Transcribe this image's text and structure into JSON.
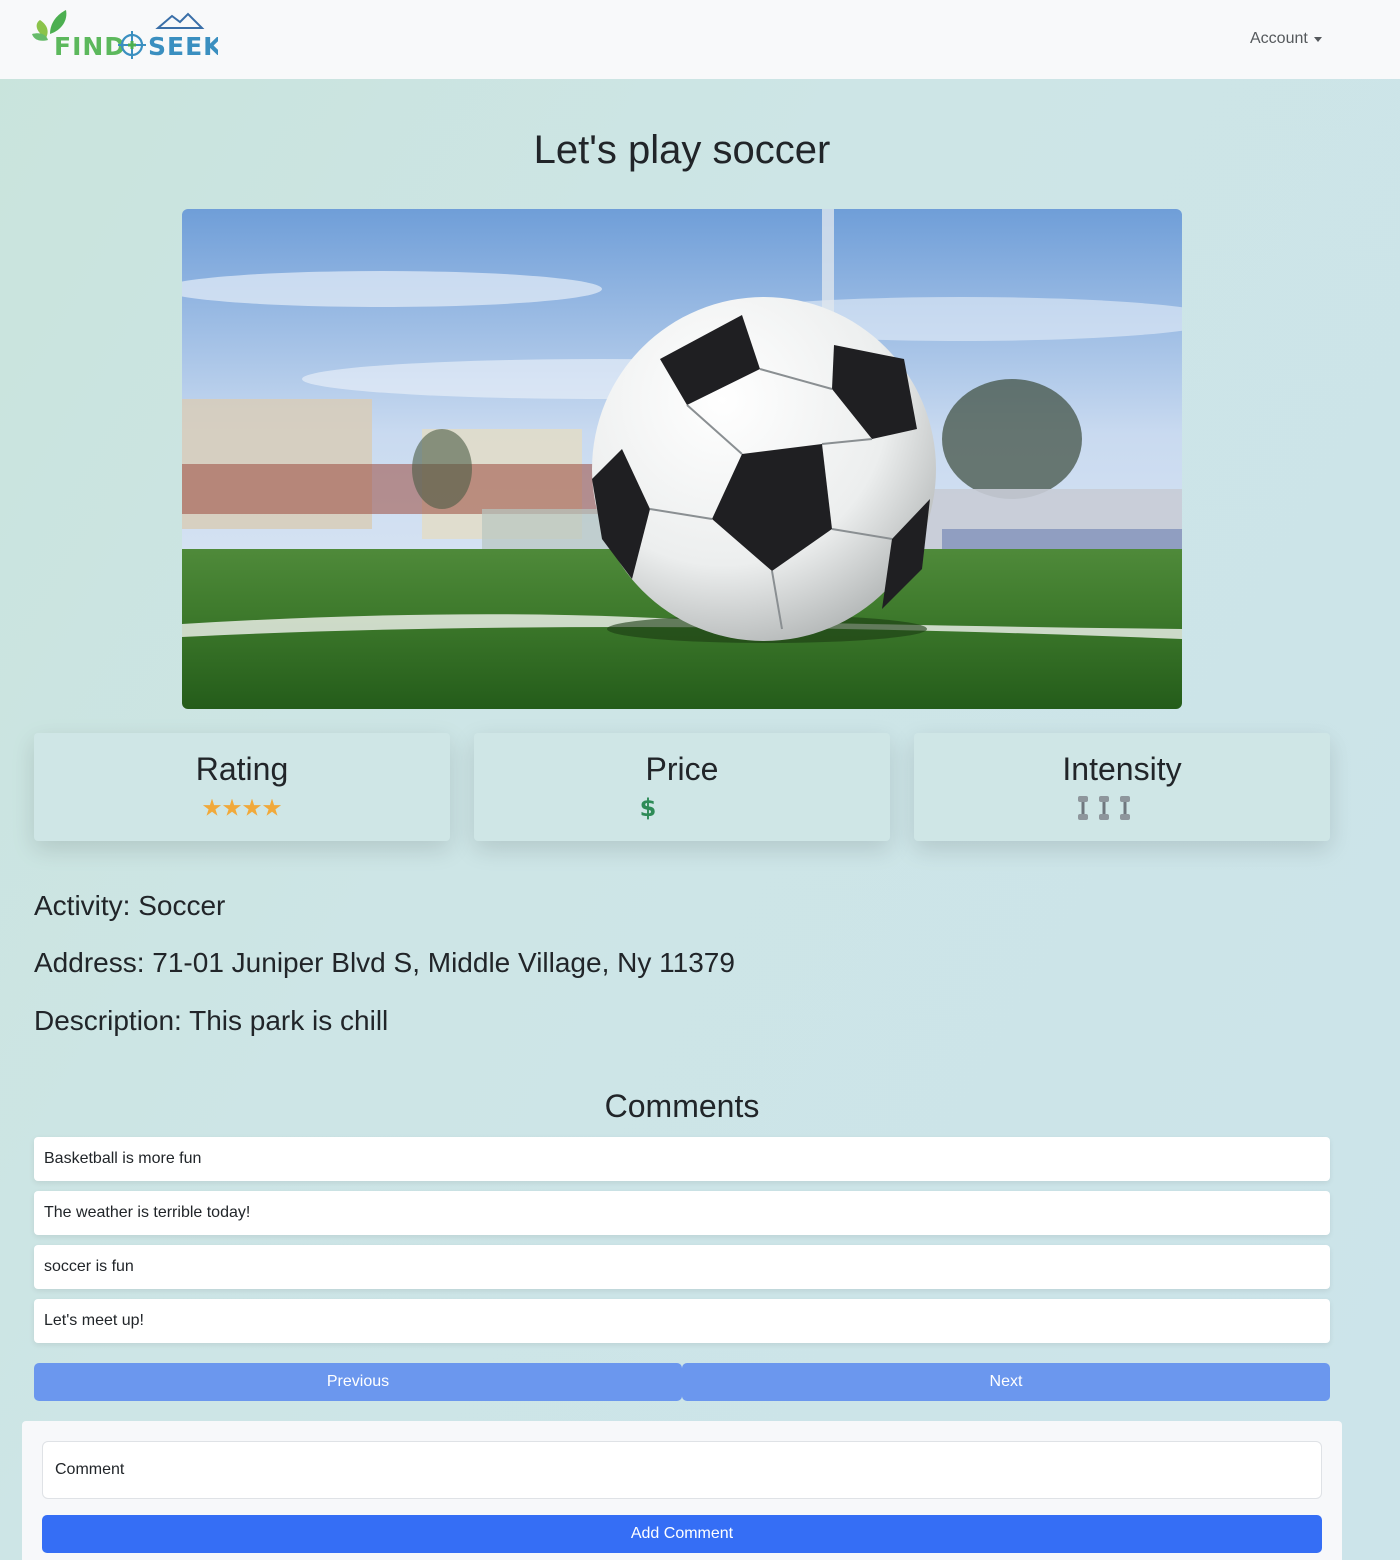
{
  "navbar": {
    "logo_text_left": "FIND",
    "logo_text_right": "SEEK",
    "account_label": "Account"
  },
  "page": {
    "title": "Let's play soccer"
  },
  "stats": {
    "rating": {
      "label": "Rating",
      "value": 4,
      "icon": "star-icon"
    },
    "price": {
      "label": "Price",
      "value": 1,
      "symbol": "$",
      "icon": "dollar-icon"
    },
    "intensity": {
      "label": "Intensity",
      "value": 3,
      "icon": "dumbbell-icon"
    }
  },
  "details": {
    "activity": "Activity: Soccer",
    "address": "Address: 71-01 Juniper Blvd S, Middle Village, Ny 11379",
    "description": "Description: This park is chill"
  },
  "comments": {
    "heading": "Comments",
    "items": [
      "Basketball is more fun",
      "The weather is terrible today!",
      "soccer is fun",
      "Let's meet up!"
    ],
    "previous_label": "Previous",
    "next_label": "Next"
  },
  "form": {
    "placeholder": "Comment",
    "submit_label": "Add Comment"
  },
  "colors": {
    "accent": "#356ef5",
    "pager": "#6b97ee",
    "logo_green": "#5cb85c",
    "logo_blue": "#3a8fc0"
  }
}
